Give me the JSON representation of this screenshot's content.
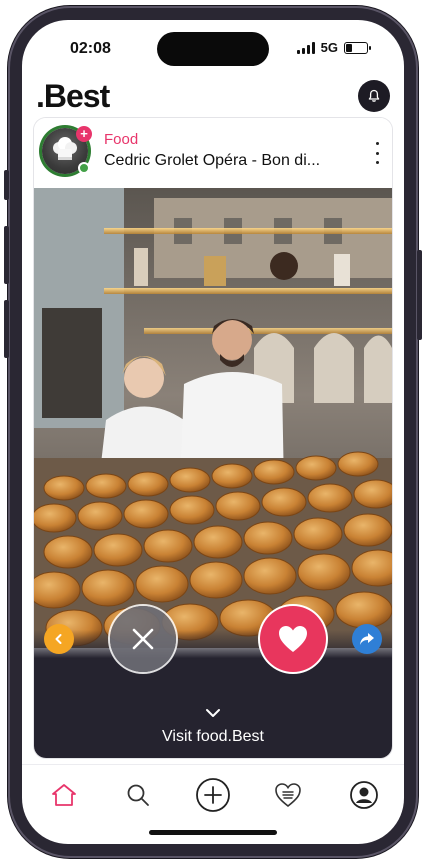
{
  "status_bar": {
    "time": "02:08",
    "network": "5G",
    "battery_level": 0.3
  },
  "header": {
    "logo": ".Best",
    "bell_icon": "bell-icon"
  },
  "post": {
    "category": "Food",
    "title": "Cedric Grolet Opéra - Bon di...",
    "menu_icon": "kebab-menu-icon",
    "photo_icon": "bakery-photo"
  },
  "actions": {
    "prev_icon": "chevron-left-icon",
    "dismiss_icon": "close-icon",
    "like_icon": "heart-icon",
    "share_icon": "share-arrow-icon"
  },
  "footer": {
    "visit_label": "Visit food.Best"
  },
  "bottom_nav": {
    "items": [
      {
        "icon": "home-icon",
        "active": true
      },
      {
        "icon": "search-icon",
        "active": false
      },
      {
        "icon": "add-icon",
        "active": false
      },
      {
        "icon": "heart-list-icon",
        "active": false
      },
      {
        "icon": "profile-icon",
        "active": false
      }
    ]
  },
  "colors": {
    "accent": "#e8356b",
    "dark": "#25232f",
    "prev": "#f5a623",
    "share": "#2f7fd6"
  }
}
